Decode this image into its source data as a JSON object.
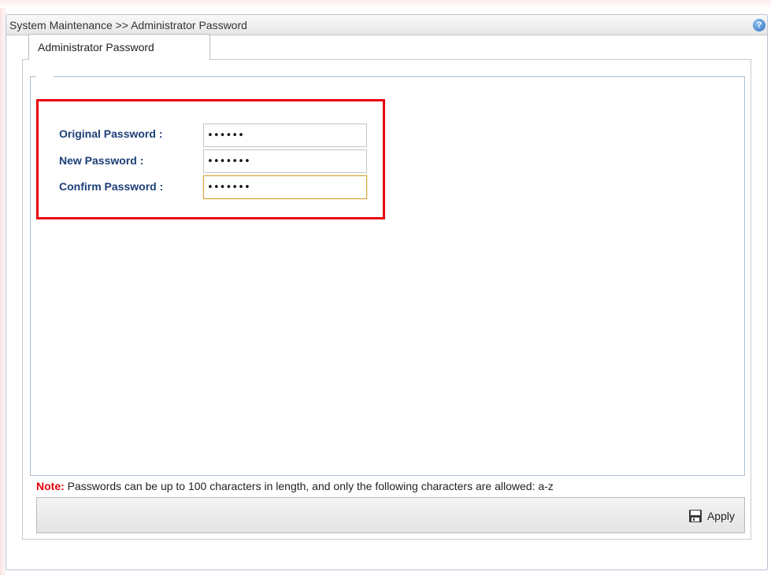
{
  "window": {
    "title": "System Maintenance >> Administrator Password",
    "help_icon": "help-icon"
  },
  "tabs": [
    {
      "label": "Administrator Password",
      "active": true
    }
  ],
  "form": {
    "original_password": {
      "label": "Original Password :",
      "value": "••••••"
    },
    "new_password": {
      "label": "New Password :",
      "value": "•••••••"
    },
    "confirm_password": {
      "label": "Confirm Password :",
      "value": "•••••••"
    }
  },
  "note": {
    "label": "Note:",
    "text": " Passwords can be up to 100 characters in length, and only the following characters are allowed: a-z"
  },
  "actions": {
    "apply_label": "Apply",
    "apply_icon": "save-icon"
  },
  "colors": {
    "highlight_border": "#e8000d",
    "label_text": "#1c3f78",
    "note_label": "#e4000b",
    "help_icon": "#2e6fc0"
  }
}
